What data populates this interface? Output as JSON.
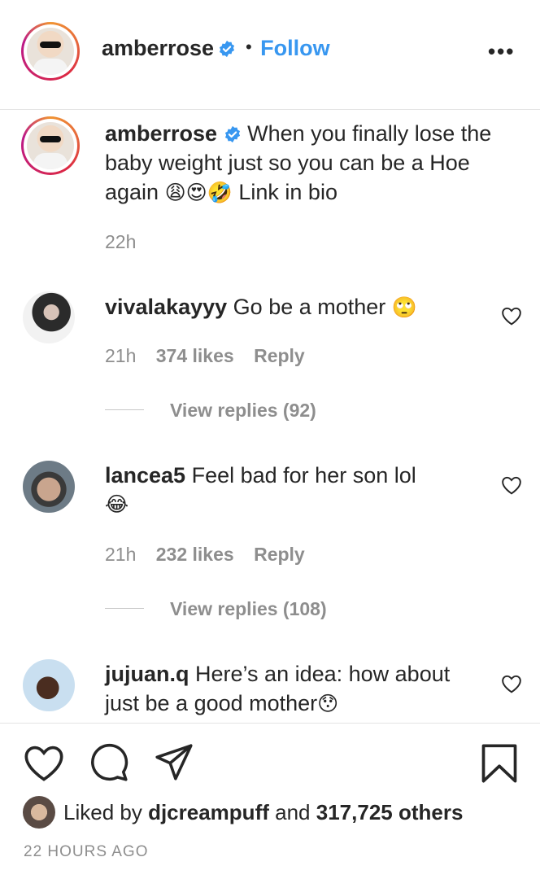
{
  "header": {
    "username": "amberrose",
    "separator": "•",
    "follow_label": "Follow",
    "more_icon": "more-options-icon",
    "more_glyph": "•••"
  },
  "caption": {
    "username": "amberrose",
    "text_line1": "When you finally lose the",
    "text_line2": "baby weight just so you can be a Hoe",
    "text_line3_pre": "again",
    "emojis": [
      "😩",
      "😍",
      "🤣"
    ],
    "text_line3_post": "Link in bio",
    "time": "22h"
  },
  "comments": [
    {
      "username": "vivalakayyy",
      "text": "Go be a mother",
      "emoji": "🙄",
      "time": "21h",
      "likes": "374 likes",
      "reply": "Reply",
      "view_replies": "View replies (92)"
    },
    {
      "username": "lancea5",
      "text": "Feel bad for her son lol",
      "emoji": "😂",
      "time": "21h",
      "likes": "232 likes",
      "reply": "Reply",
      "view_replies": "View replies (108)"
    },
    {
      "username": "jujuan.q",
      "text_line1": "Here’s an idea: how about",
      "text_line2": "just be a good mother",
      "emoji": "😯"
    }
  ],
  "actions": {
    "like_icon": "heart-icon",
    "comment_icon": "comment-icon",
    "share_icon": "send-icon",
    "save_icon": "bookmark-icon"
  },
  "likes": {
    "prefix": "Liked by",
    "user": "djcreampuff",
    "and": "and",
    "others": "317,725 others"
  },
  "timestamp": "22 HOURS AGO",
  "colors": {
    "link_blue": "#3897f0",
    "verified_blue": "#3897f0",
    "meta_grey": "#8e8e8e",
    "text": "#262626"
  }
}
